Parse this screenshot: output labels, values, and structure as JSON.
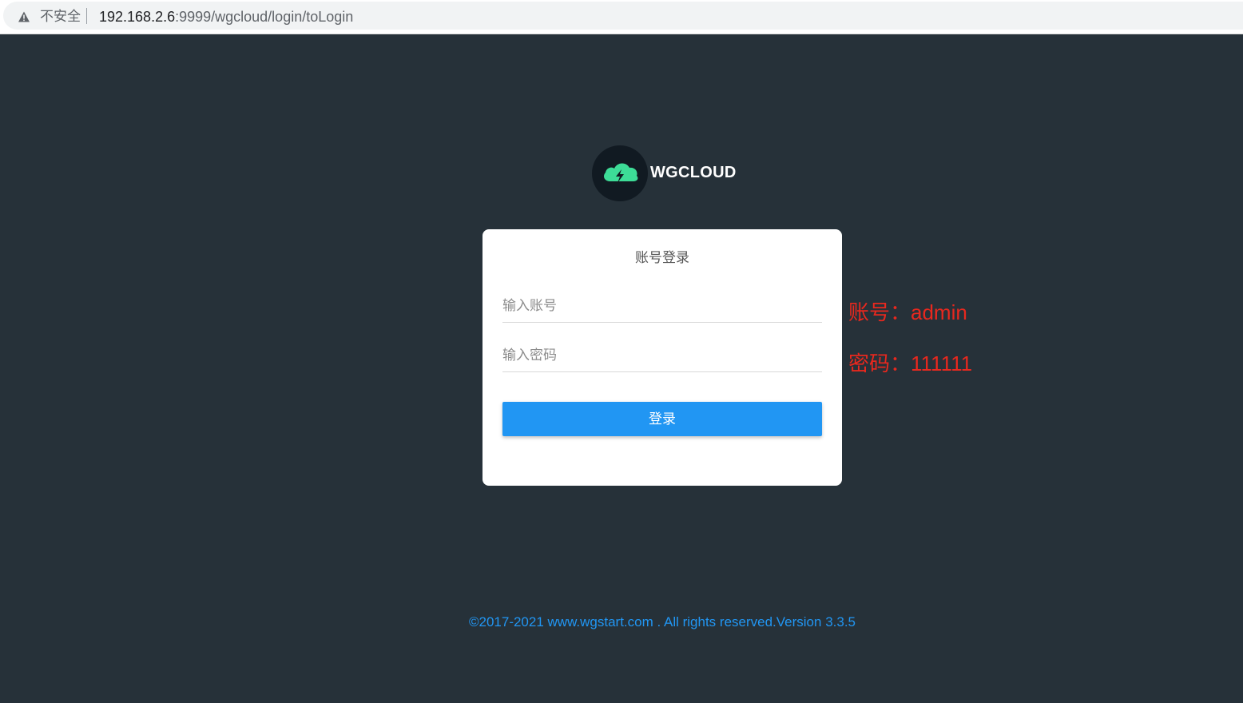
{
  "browser": {
    "security_label": "不安全",
    "url_host": "192.168.2.6",
    "url_rest": ":9999/wgcloud/login/toLogin"
  },
  "brand": {
    "name": "WGCLOUD",
    "icon": "cloud-bolt-icon",
    "icon_color": "#3ddc97"
  },
  "login": {
    "title": "账号登录",
    "username_placeholder": "输入账号",
    "username_value": "",
    "password_placeholder": "输入密码",
    "password_value": "",
    "submit_label": "登录",
    "button_color": "#2196f3"
  },
  "annotations": {
    "username_note": "账号：admin",
    "password_note": "密码：111111",
    "color": "#e8281e"
  },
  "footer": {
    "text": "©2017-2021 www.wgstart.com . All rights reserved.Version 3.3.5"
  }
}
